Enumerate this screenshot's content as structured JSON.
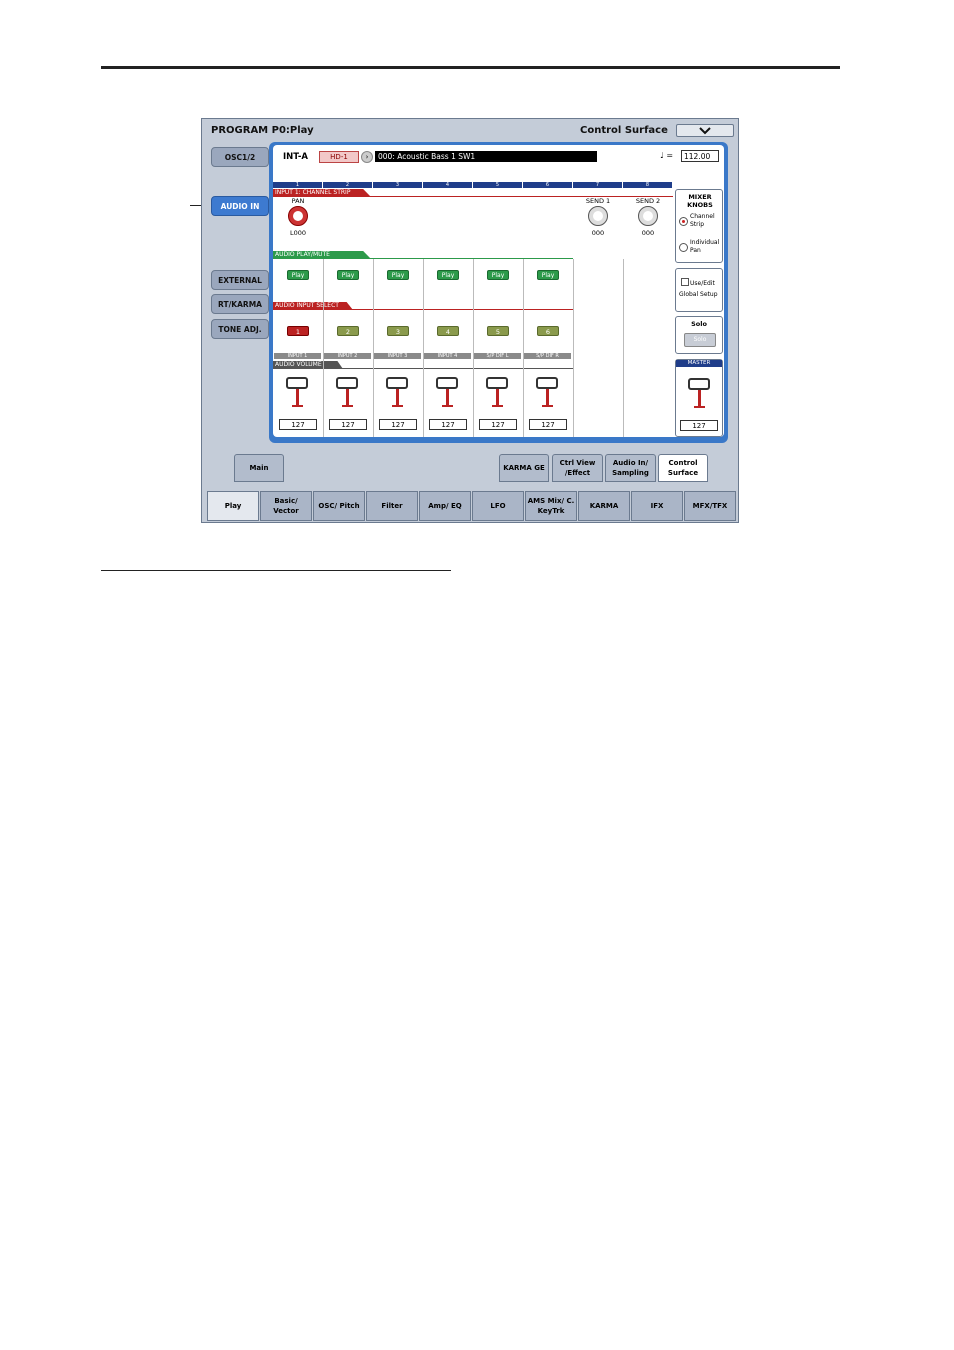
{
  "screen": {
    "title": "PROGRAM P0:Play",
    "page_name": "Control Surface"
  },
  "side_tabs": [
    "OSC1/2",
    "AUDIO IN",
    "EXTERNAL",
    "RT/KARMA",
    "TONE ADJ."
  ],
  "active_side_tab": "AUDIO IN",
  "program": {
    "bank": "INT-A",
    "badge": "HD-1",
    "name": "000: Acoustic Bass 1 SW1",
    "tempo_label": "♩ =",
    "tempo": "112.00"
  },
  "channels": [
    "1",
    "2",
    "3",
    "4",
    "5",
    "6",
    "7",
    "8"
  ],
  "channel_strip": {
    "header": "INPUT 1: CHANNEL STRIP",
    "pan_label": "PAN",
    "pan_value": "L000",
    "send1_label": "SEND 1",
    "send1_value": "000",
    "send2_label": "SEND 2",
    "send2_value": "000"
  },
  "play_mute": {
    "header": "AUDIO PLAY/MUTE",
    "buttons": [
      "Play",
      "Play",
      "Play",
      "Play",
      "Play",
      "Play"
    ]
  },
  "input_select": {
    "header": "AUDIO INPUT SELECT",
    "buttons": [
      "1",
      "2",
      "3",
      "4",
      "5",
      "6"
    ],
    "labels": [
      "INPUT 1",
      "INPUT 2",
      "INPUT 3",
      "INPUT 4",
      "S/P DIF L",
      "S/P DIF R"
    ]
  },
  "volume": {
    "header": "AUDIO VOLUME",
    "values": [
      "127",
      "127",
      "127",
      "127",
      "127",
      "127"
    ]
  },
  "mixer_knobs": {
    "title": "MIXER KNOBS",
    "option1": "Channel Strip",
    "option2": "Individual Pan"
  },
  "global_setup": {
    "label": "Use/Edit Global Setup"
  },
  "solo": {
    "title": "Solo",
    "button": "Solo"
  },
  "master": {
    "label": "MASTER",
    "value": "127"
  },
  "sub_tabs": [
    "Main",
    "KARMA GE",
    "Ctrl View /Effect",
    "Audio In/ Sampling",
    "Control Surface"
  ],
  "main_tabs": [
    "Play",
    "Basic/ Vector",
    "OSC/ Pitch",
    "Filter",
    "Amp/ EQ",
    "LFO",
    "AMS Mix/ C. KeyTrk",
    "KARMA",
    "IFX",
    "MFX/TFX"
  ],
  "colors": {
    "accent": "#3a78c8",
    "strip": "#b22222",
    "play": "#2c9a4a"
  }
}
